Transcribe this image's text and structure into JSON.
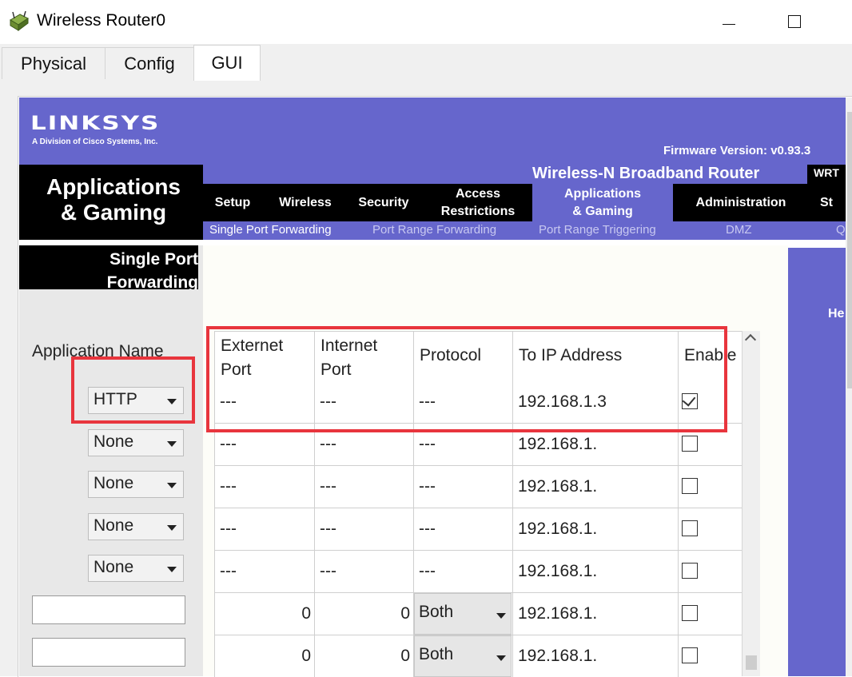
{
  "window": {
    "title": "Wireless Router0",
    "minimize_glyph": "—",
    "maximize_glyph": "☐"
  },
  "device_tabs": [
    {
      "label": "Physical"
    },
    {
      "label": "Config"
    },
    {
      "label": "GUI",
      "active": true
    }
  ],
  "router": {
    "brand": "LINKSYS",
    "brand_sub": "A Division of Cisco Systems, Inc.",
    "firmware": "Firmware Version: v0.93.3",
    "product_name": "Wireless-N Broadband Router",
    "model": "WRT",
    "section_title_line1": "Applications",
    "section_title_line2": "& Gaming",
    "nav": [
      {
        "label": "Setup"
      },
      {
        "label": "Wireless"
      },
      {
        "label": "Security"
      },
      {
        "label": "Access Restrictions",
        "line1": "Access",
        "line2": "Restrictions"
      },
      {
        "label": "Applications & Gaming",
        "line1": "Applications",
        "line2": "& Gaming",
        "active": true
      },
      {
        "label": "Administration"
      },
      {
        "label": "St"
      }
    ],
    "subnav": [
      {
        "label": "Single Port Forwarding",
        "active": true
      },
      {
        "label": "Port Range Forwarding"
      },
      {
        "label": "Port Range Triggering"
      },
      {
        "label": "DMZ"
      },
      {
        "label": "Q"
      }
    ],
    "left_heading_line1": "Single Port",
    "left_heading_line2": "Forwarding",
    "application_name_label": "Application Name",
    "help_label": "He"
  },
  "table": {
    "columns": [
      {
        "line1": "Externet",
        "line2": "Port"
      },
      {
        "line1": "Internet",
        "line2": "Port"
      },
      {
        "line1": "Protocol",
        "line2": ""
      },
      {
        "line1": "To IP Address",
        "line2": ""
      },
      {
        "line1": "Enable",
        "line2": ""
      }
    ],
    "rows": [
      {
        "app": "HTTP",
        "app_type": "select",
        "ext": "---",
        "int": "---",
        "protocol": "---",
        "protocol_type": "text",
        "ip": "192.168.1.3",
        "enabled": true
      },
      {
        "app": "None",
        "app_type": "select",
        "ext": "---",
        "int": "---",
        "protocol": "---",
        "protocol_type": "text",
        "ip": "192.168.1.",
        "enabled": false
      },
      {
        "app": "None",
        "app_type": "select",
        "ext": "---",
        "int": "---",
        "protocol": "---",
        "protocol_type": "text",
        "ip": "192.168.1.",
        "enabled": false
      },
      {
        "app": "None",
        "app_type": "select",
        "ext": "---",
        "int": "---",
        "protocol": "---",
        "protocol_type": "text",
        "ip": "192.168.1.",
        "enabled": false
      },
      {
        "app": "None",
        "app_type": "select",
        "ext": "---",
        "int": "---",
        "protocol": "---",
        "protocol_type": "text",
        "ip": "192.168.1.",
        "enabled": false
      },
      {
        "app": "",
        "app_type": "input",
        "ext": "0",
        "int": "0",
        "protocol": "Both",
        "protocol_type": "select",
        "ip": "192.168.1.",
        "enabled": false
      },
      {
        "app": "",
        "app_type": "input",
        "ext": "0",
        "int": "0",
        "protocol": "Both",
        "protocol_type": "select",
        "ip": "192.168.1.",
        "enabled": false
      }
    ]
  },
  "colors": {
    "linksys_purple": "#6666cc",
    "highlight_red": "#e8353d"
  }
}
